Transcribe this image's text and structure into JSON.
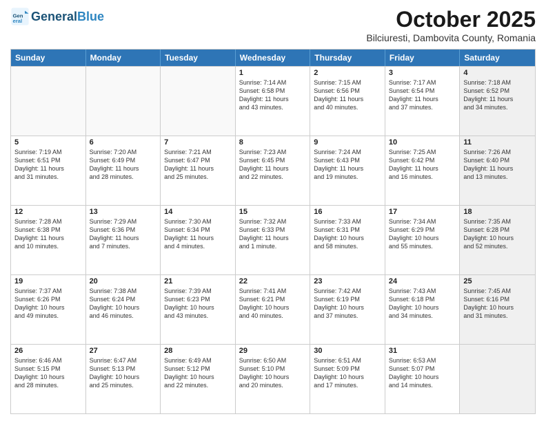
{
  "header": {
    "logo_general": "General",
    "logo_blue": "Blue",
    "month": "October 2025",
    "location": "Bilciuresti, Dambovita County, Romania"
  },
  "days_of_week": [
    "Sunday",
    "Monday",
    "Tuesday",
    "Wednesday",
    "Thursday",
    "Friday",
    "Saturday"
  ],
  "weeks": [
    [
      {
        "day": "",
        "info": [],
        "empty": true
      },
      {
        "day": "",
        "info": [],
        "empty": true
      },
      {
        "day": "",
        "info": [],
        "empty": true
      },
      {
        "day": "1",
        "info": [
          "Sunrise: 7:14 AM",
          "Sunset: 6:58 PM",
          "Daylight: 11 hours",
          "and 43 minutes."
        ],
        "empty": false
      },
      {
        "day": "2",
        "info": [
          "Sunrise: 7:15 AM",
          "Sunset: 6:56 PM",
          "Daylight: 11 hours",
          "and 40 minutes."
        ],
        "empty": false
      },
      {
        "day": "3",
        "info": [
          "Sunrise: 7:17 AM",
          "Sunset: 6:54 PM",
          "Daylight: 11 hours",
          "and 37 minutes."
        ],
        "empty": false
      },
      {
        "day": "4",
        "info": [
          "Sunrise: 7:18 AM",
          "Sunset: 6:52 PM",
          "Daylight: 11 hours",
          "and 34 minutes."
        ],
        "empty": false,
        "shaded": true
      }
    ],
    [
      {
        "day": "5",
        "info": [
          "Sunrise: 7:19 AM",
          "Sunset: 6:51 PM",
          "Daylight: 11 hours",
          "and 31 minutes."
        ],
        "empty": false
      },
      {
        "day": "6",
        "info": [
          "Sunrise: 7:20 AM",
          "Sunset: 6:49 PM",
          "Daylight: 11 hours",
          "and 28 minutes."
        ],
        "empty": false
      },
      {
        "day": "7",
        "info": [
          "Sunrise: 7:21 AM",
          "Sunset: 6:47 PM",
          "Daylight: 11 hours",
          "and 25 minutes."
        ],
        "empty": false
      },
      {
        "day": "8",
        "info": [
          "Sunrise: 7:23 AM",
          "Sunset: 6:45 PM",
          "Daylight: 11 hours",
          "and 22 minutes."
        ],
        "empty": false
      },
      {
        "day": "9",
        "info": [
          "Sunrise: 7:24 AM",
          "Sunset: 6:43 PM",
          "Daylight: 11 hours",
          "and 19 minutes."
        ],
        "empty": false
      },
      {
        "day": "10",
        "info": [
          "Sunrise: 7:25 AM",
          "Sunset: 6:42 PM",
          "Daylight: 11 hours",
          "and 16 minutes."
        ],
        "empty": false
      },
      {
        "day": "11",
        "info": [
          "Sunrise: 7:26 AM",
          "Sunset: 6:40 PM",
          "Daylight: 11 hours",
          "and 13 minutes."
        ],
        "empty": false,
        "shaded": true
      }
    ],
    [
      {
        "day": "12",
        "info": [
          "Sunrise: 7:28 AM",
          "Sunset: 6:38 PM",
          "Daylight: 11 hours",
          "and 10 minutes."
        ],
        "empty": false
      },
      {
        "day": "13",
        "info": [
          "Sunrise: 7:29 AM",
          "Sunset: 6:36 PM",
          "Daylight: 11 hours",
          "and 7 minutes."
        ],
        "empty": false
      },
      {
        "day": "14",
        "info": [
          "Sunrise: 7:30 AM",
          "Sunset: 6:34 PM",
          "Daylight: 11 hours",
          "and 4 minutes."
        ],
        "empty": false
      },
      {
        "day": "15",
        "info": [
          "Sunrise: 7:32 AM",
          "Sunset: 6:33 PM",
          "Daylight: 11 hours",
          "and 1 minute."
        ],
        "empty": false
      },
      {
        "day": "16",
        "info": [
          "Sunrise: 7:33 AM",
          "Sunset: 6:31 PM",
          "Daylight: 10 hours",
          "and 58 minutes."
        ],
        "empty": false
      },
      {
        "day": "17",
        "info": [
          "Sunrise: 7:34 AM",
          "Sunset: 6:29 PM",
          "Daylight: 10 hours",
          "and 55 minutes."
        ],
        "empty": false
      },
      {
        "day": "18",
        "info": [
          "Sunrise: 7:35 AM",
          "Sunset: 6:28 PM",
          "Daylight: 10 hours",
          "and 52 minutes."
        ],
        "empty": false,
        "shaded": true
      }
    ],
    [
      {
        "day": "19",
        "info": [
          "Sunrise: 7:37 AM",
          "Sunset: 6:26 PM",
          "Daylight: 10 hours",
          "and 49 minutes."
        ],
        "empty": false
      },
      {
        "day": "20",
        "info": [
          "Sunrise: 7:38 AM",
          "Sunset: 6:24 PM",
          "Daylight: 10 hours",
          "and 46 minutes."
        ],
        "empty": false
      },
      {
        "day": "21",
        "info": [
          "Sunrise: 7:39 AM",
          "Sunset: 6:23 PM",
          "Daylight: 10 hours",
          "and 43 minutes."
        ],
        "empty": false
      },
      {
        "day": "22",
        "info": [
          "Sunrise: 7:41 AM",
          "Sunset: 6:21 PM",
          "Daylight: 10 hours",
          "and 40 minutes."
        ],
        "empty": false
      },
      {
        "day": "23",
        "info": [
          "Sunrise: 7:42 AM",
          "Sunset: 6:19 PM",
          "Daylight: 10 hours",
          "and 37 minutes."
        ],
        "empty": false
      },
      {
        "day": "24",
        "info": [
          "Sunrise: 7:43 AM",
          "Sunset: 6:18 PM",
          "Daylight: 10 hours",
          "and 34 minutes."
        ],
        "empty": false
      },
      {
        "day": "25",
        "info": [
          "Sunrise: 7:45 AM",
          "Sunset: 6:16 PM",
          "Daylight: 10 hours",
          "and 31 minutes."
        ],
        "empty": false,
        "shaded": true
      }
    ],
    [
      {
        "day": "26",
        "info": [
          "Sunrise: 6:46 AM",
          "Sunset: 5:15 PM",
          "Daylight: 10 hours",
          "and 28 minutes."
        ],
        "empty": false
      },
      {
        "day": "27",
        "info": [
          "Sunrise: 6:47 AM",
          "Sunset: 5:13 PM",
          "Daylight: 10 hours",
          "and 25 minutes."
        ],
        "empty": false
      },
      {
        "day": "28",
        "info": [
          "Sunrise: 6:49 AM",
          "Sunset: 5:12 PM",
          "Daylight: 10 hours",
          "and 22 minutes."
        ],
        "empty": false
      },
      {
        "day": "29",
        "info": [
          "Sunrise: 6:50 AM",
          "Sunset: 5:10 PM",
          "Daylight: 10 hours",
          "and 20 minutes."
        ],
        "empty": false
      },
      {
        "day": "30",
        "info": [
          "Sunrise: 6:51 AM",
          "Sunset: 5:09 PM",
          "Daylight: 10 hours",
          "and 17 minutes."
        ],
        "empty": false
      },
      {
        "day": "31",
        "info": [
          "Sunrise: 6:53 AM",
          "Sunset: 5:07 PM",
          "Daylight: 10 hours",
          "and 14 minutes."
        ],
        "empty": false
      },
      {
        "day": "",
        "info": [],
        "empty": true,
        "shaded": true
      }
    ]
  ]
}
